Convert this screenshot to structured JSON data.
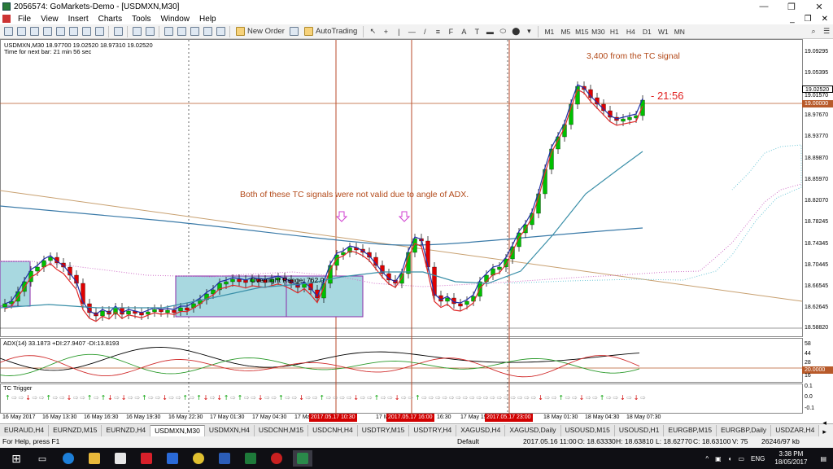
{
  "window": {
    "title": "2056574: GoMarkets-Demo - [USDMXN,M30]"
  },
  "menu": {
    "items": [
      "File",
      "View",
      "Insert",
      "Charts",
      "Tools",
      "Window",
      "Help"
    ],
    "right": [
      "_",
      "❐",
      "✕"
    ]
  },
  "toolbar": {
    "new_order": "New Order",
    "autotrading": "AutoTrading",
    "timeframes": [
      "M1",
      "M5",
      "M15",
      "M30",
      "H1",
      "H4",
      "D1",
      "W1",
      "MN"
    ]
  },
  "chart": {
    "symbol_info": "USDMXN,M30  18.97700 19.02520 18.97310 19.02520",
    "next_bar": "Time for next bar: 21 min 56 sec",
    "annotation_top": "3,400 from the TC signal",
    "annotation_mid": "Both of these TC signals were not valid due to angle of  ADX.",
    "countdown": "21:56",
    "range_label": "Overnight Range, 762.0",
    "price_axis": [
      "19.09295",
      "19.05395",
      "19.02520",
      "19.01570",
      "19.00000",
      "18.97670",
      "18.93770",
      "18.89870",
      "18.85970",
      "18.82070",
      "18.78245",
      "18.74345",
      "18.70445",
      "18.66545",
      "18.62645",
      "18.58820"
    ],
    "adx_label": "ADX(14) 33.1873 +DI:27.9407 -DI:13.8193",
    "adx_axis": [
      "58",
      "44",
      "28",
      "20.0000",
      "16"
    ],
    "tc_label": "TC Trigger",
    "tc_axis": [
      "0.1",
      "0.0",
      "-0.1"
    ],
    "time_axis": [
      "16 May 2017",
      "16 May 13:30",
      "16 May 16:30",
      "16 May 19:30",
      "16 May 22:30",
      "17 May 01:30",
      "17 May 04:30",
      "17 May",
      "17 May",
      "16:30",
      "17 May 19",
      "18 May 01:30",
      "18 May 04:30",
      "18 May 07:30"
    ],
    "time_highlights": [
      "2017.05.17 10:30",
      "2017.05.17 16:00",
      "2017.05.17 23:00"
    ],
    "colors": {
      "bull": "#00c000",
      "bear": "#e00000",
      "ma_fast": "#1f2fa8",
      "ma_mid": "#e02a2a",
      "ma_slow": "#3a8fa8",
      "range_fill": "#a8d8e0",
      "range_border": "#8a2aa8"
    }
  },
  "tabs": {
    "items": [
      "EURAUD,H4",
      "EURNZD,M15",
      "EURNZD,H4",
      "USDMXN,M30",
      "USDMXN,H4",
      "USDCNH,M15",
      "USDCNH,H4",
      "USDTRY,M15",
      "USDTRY,H4",
      "XAGUSD,H4",
      "XAGUSD,Daily",
      "USOUSD,M15",
      "USOUSD,H1",
      "EURGBP,M15",
      "EURGBP,Daily",
      "USDZAR,H4"
    ],
    "active": "USDMXN,M30"
  },
  "status": {
    "help": "For Help, press F1",
    "profile": "Default",
    "datetime": "2017.05.16 11:00",
    "open": "O: 18.63330",
    "high": "H: 18.63810",
    "low": "L: 18.62770",
    "close": "C: 18.63100",
    "volume": "V: 75",
    "traffic": "26246/97 kb"
  },
  "taskbar": {
    "lang": "ENG",
    "time": "3:38 PM",
    "date": "18/05/2017"
  }
}
